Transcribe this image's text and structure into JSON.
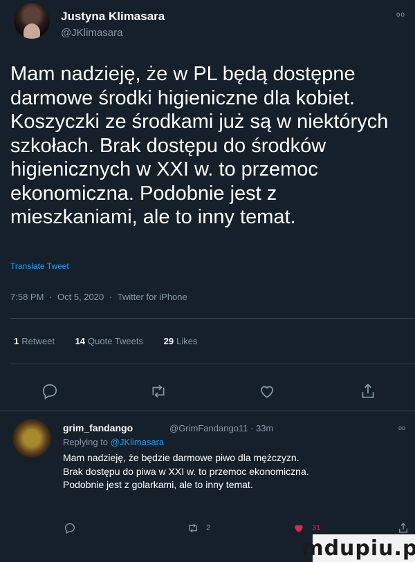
{
  "tweet": {
    "author_name": "Justyna Klimasara",
    "author_handle": "@JKlimasara",
    "text_lines": [
      "Mam nadzieję, że w PL będą dostępne",
      "darmowe środki higieniczne dla kobiet.",
      "Koszyczki ze środkami już są w niektórych",
      "szkołach. Brak dostępu do środków",
      "higienicznych w XXI w. to przemoc",
      "ekonomiczna. Podobnie jest z",
      "mieszkaniami, ale to inny temat."
    ],
    "translate": "Translate Tweet",
    "time": "7:58 PM",
    "date": "Oct 5, 2020",
    "source": "Twitter for iPhone",
    "separator": "·",
    "retweets_count": "1",
    "retweets_label": "Retweet",
    "quotes_count": "14",
    "quotes_label": "Quote Tweets",
    "likes_count": "29",
    "likes_label": "Likes",
    "more_icon": "oo"
  },
  "actions": [
    {
      "icon": "comment-icon"
    },
    {
      "icon": "retweet-icon"
    },
    {
      "icon": "heart-icon"
    },
    {
      "icon": "share-icon"
    }
  ],
  "reply": {
    "author_name": "grim_fandango",
    "handle_time": "@GrimFandango11 · 33m",
    "replying_prefix": "Replying to",
    "replying_to": "@JKlimasara",
    "text_lines": [
      "Mam nadzieję, że będzie darmowe piwo dla mężczyzn.",
      "Brak dostępu do piwa w XXI w. to przemoc ekonomiczna.",
      "Podobnie jest z golarkami, ale to inny temat."
    ],
    "retweet_count": "2",
    "like_count": "31",
    "more_icon": "oo"
  },
  "watermark": "mdupiu.pl",
  "colors": {
    "background": "#15202b",
    "text": "#ffffff",
    "secondary": "#8899a6",
    "link": "#1da1f2",
    "like": "#e0245e",
    "divider": "#38444d"
  }
}
